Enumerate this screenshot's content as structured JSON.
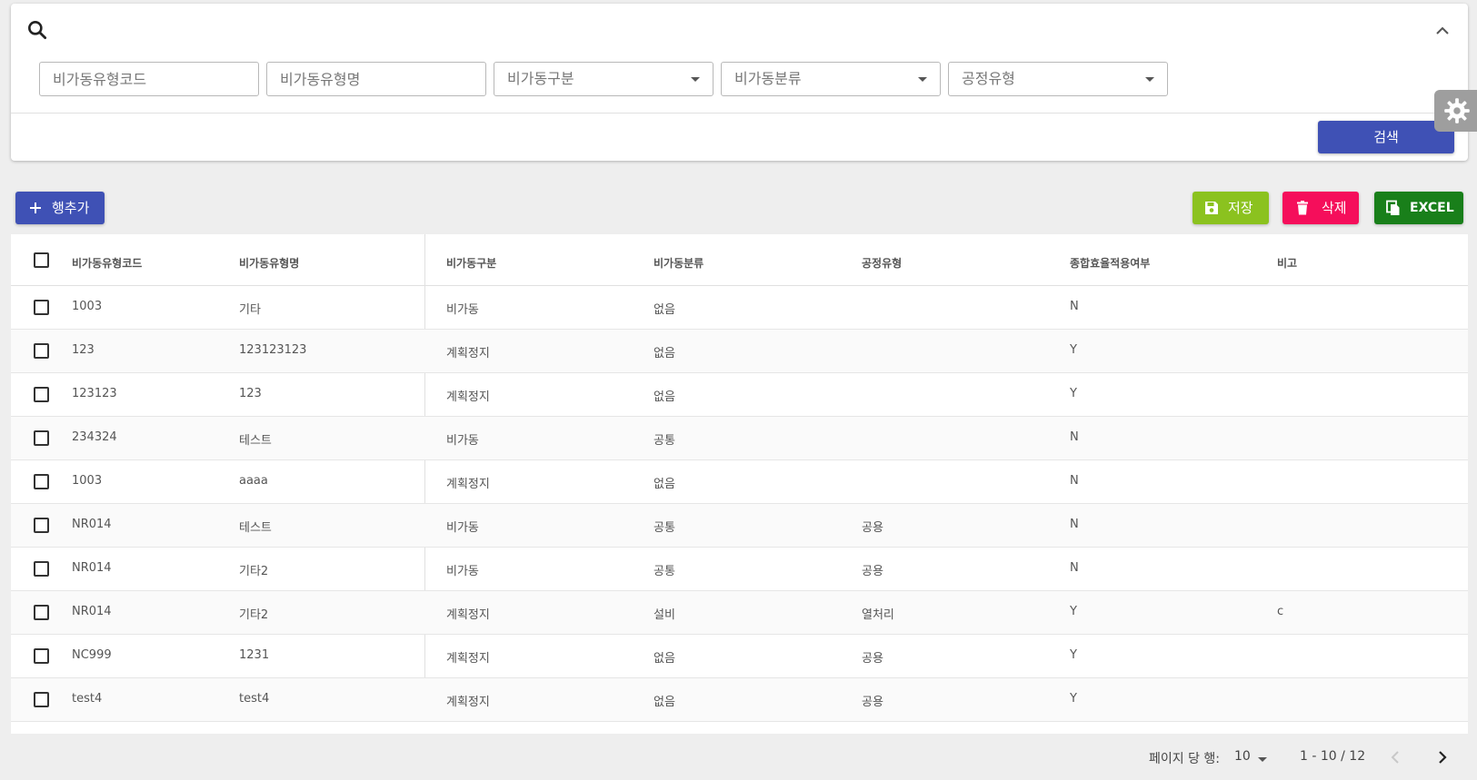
{
  "search": {
    "fields": [
      {
        "placeholder": "비가동유형코드",
        "type": "text"
      },
      {
        "placeholder": "비가동유형명",
        "type": "text"
      },
      {
        "placeholder": "비가동구분",
        "type": "select"
      },
      {
        "placeholder": "비가동분류",
        "type": "select"
      },
      {
        "placeholder": "공정유형",
        "type": "select"
      }
    ],
    "search_label": "검색"
  },
  "toolbar": {
    "add_label": "행추가",
    "save_label": "저장",
    "delete_label": "삭제",
    "excel_label": "EXCEL"
  },
  "colors": {
    "primary": "#3f51b5",
    "save": "#8bc21f",
    "delete": "#f50e5b",
    "excel": "#197f1a"
  },
  "grid": {
    "columns": [
      "비가동유형코드",
      "비가동유형명",
      "비가동구분",
      "비가동분류",
      "공정유형",
      "종합효율적용여부",
      "비고"
    ],
    "rows": [
      [
        "1003",
        "기타",
        "비가동",
        "없음",
        "",
        "N",
        ""
      ],
      [
        "123",
        "123123123",
        "계획정지",
        "없음",
        "",
        "Y",
        ""
      ],
      [
        "123123",
        "123",
        "계획정지",
        "없음",
        "",
        "Y",
        ""
      ],
      [
        "234324",
        "테스트",
        "비가동",
        "공통",
        "",
        "N",
        ""
      ],
      [
        "1003",
        "aaaa",
        "계획정지",
        "없음",
        "",
        "N",
        ""
      ],
      [
        "NR014",
        "테스트",
        "비가동",
        "공통",
        "공용",
        "N",
        ""
      ],
      [
        "NR014",
        "기타2",
        "비가동",
        "공통",
        "공용",
        "N",
        ""
      ],
      [
        "NR014",
        "기타2",
        "계획정지",
        "설비",
        "열처리",
        "Y",
        "c"
      ],
      [
        "NC999",
        "1231",
        "계획정지",
        "없음",
        "공용",
        "Y",
        ""
      ],
      [
        "test4",
        "test4",
        "계획정지",
        "없음",
        "공용",
        "Y",
        ""
      ]
    ]
  },
  "pagination": {
    "rows_per_page_label": "페이지 당 행:",
    "rows_per_page": "10",
    "range": "1 - 10 / 12"
  }
}
